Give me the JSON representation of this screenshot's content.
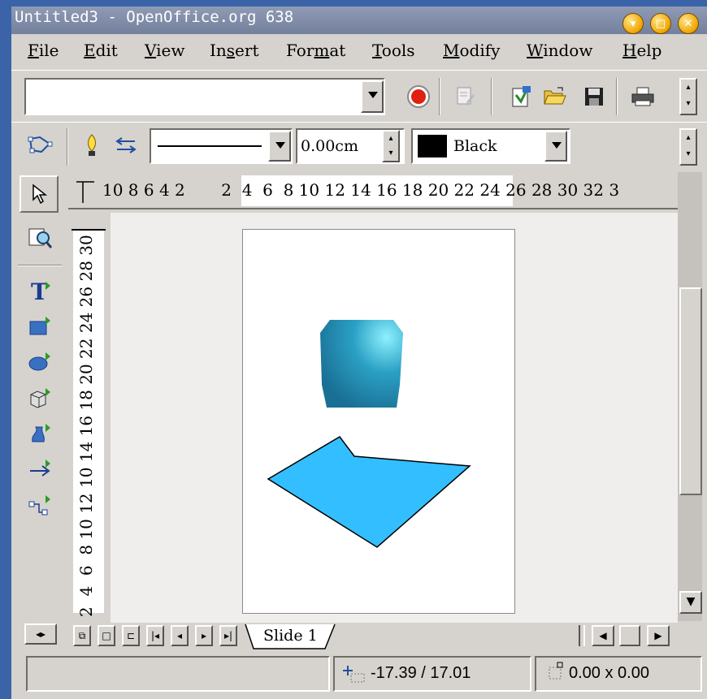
{
  "window": {
    "title": "Untitled3 - OpenOffice.org 638"
  },
  "menu": [
    {
      "pre": "",
      "u": "F",
      "post": "ile"
    },
    {
      "pre": "",
      "u": "E",
      "post": "dit"
    },
    {
      "pre": "",
      "u": "V",
      "post": "iew"
    },
    {
      "pre": "In",
      "u": "s",
      "post": "ert"
    },
    {
      "pre": "For",
      "u": "m",
      "post": "at"
    },
    {
      "pre": "",
      "u": "T",
      "post": "ools"
    },
    {
      "pre": "",
      "u": "M",
      "post": "odify"
    },
    {
      "pre": "",
      "u": "W",
      "post": "indow"
    },
    {
      "pre": "",
      "u": "H",
      "post": "elp"
    }
  ],
  "toolbar": {
    "url_value": "",
    "line_width": "0.00cm",
    "color_name": "Black",
    "color_swatch": "#000000"
  },
  "rulers": {
    "horizontal": "10 8 6 4 2       2  4  6  8 10 12 14 16 18 20 22 24 26 28 30 32 3",
    "vertical": "2  4  6  8 10 12 10 14 16 18 20 22 24 26 28 30"
  },
  "tabs": {
    "slide1": "Slide 1"
  },
  "status": {
    "position": "-17.39 / 17.01",
    "size": "0.00 x 0.00"
  },
  "colors": {
    "accent_blue": "#33bfff",
    "cube_teal": "#2a9bbd"
  }
}
